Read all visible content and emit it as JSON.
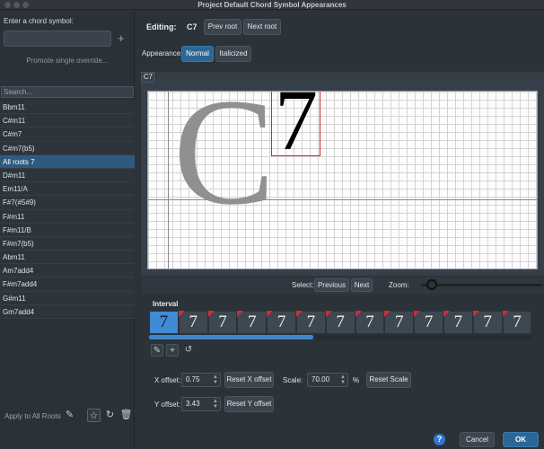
{
  "window": {
    "title": "Project Default Chord Symbol Appearances"
  },
  "left": {
    "enter_label": "Enter a chord symbol:",
    "input_value": "",
    "promote_label": "Promote single override...",
    "search_placeholder": "Search...",
    "items": [
      "Bbm11",
      "C#m11",
      "C#m7",
      "C#m7(b5)",
      "All roots 7",
      "D#m11",
      "Em11/A",
      "F#7(#5#9)",
      "F#m11",
      "F#m11/B",
      "F#m7(b5)",
      "Abm11",
      "Am7add4",
      "F#m7add4",
      "G#m11",
      "Gm7add4"
    ],
    "selected_index": 4,
    "apply_all_label": "Apply to All Roots"
  },
  "editing": {
    "label": "Editing:",
    "value": "C7",
    "prev_root": "Prev root",
    "next_root": "Next root"
  },
  "appearance": {
    "label": "Appearance:",
    "normal": "Normal",
    "italicized": "Italicized",
    "selected": "Normal"
  },
  "preview": {
    "tab_label": "C7",
    "root_glyph": "C",
    "suffix_glyph": "7"
  },
  "select_row": {
    "select_label": "Select:",
    "previous": "Previous",
    "next": "Next",
    "zoom_label": "Zoom:",
    "zoom_level": 0.05
  },
  "interval": {
    "label": "Interval",
    "cells": [
      "7",
      "7",
      "7",
      "7",
      "7",
      "7",
      "7",
      "7",
      "7",
      "7",
      "7",
      "7",
      "7"
    ],
    "selected_index": 0,
    "flagged": [
      false,
      true,
      true,
      true,
      true,
      true,
      true,
      true,
      true,
      true,
      true,
      true,
      true
    ]
  },
  "offsets": {
    "x_label": "X offset:",
    "x_value": "0.75",
    "reset_x": "Reset X offset",
    "y_label": "Y offset:",
    "y_value": "3.43",
    "reset_y": "Reset Y offset",
    "scale_label": "Scale:",
    "scale_value": "70.00",
    "scale_unit": "%",
    "reset_scale": "Reset Scale"
  },
  "footer": {
    "help": "?",
    "cancel": "Cancel",
    "ok": "OK"
  },
  "colors": {
    "accent": "#2b6796",
    "selection": "#2d5a80",
    "flag": "#d7263a",
    "help": "#2f78d4"
  }
}
